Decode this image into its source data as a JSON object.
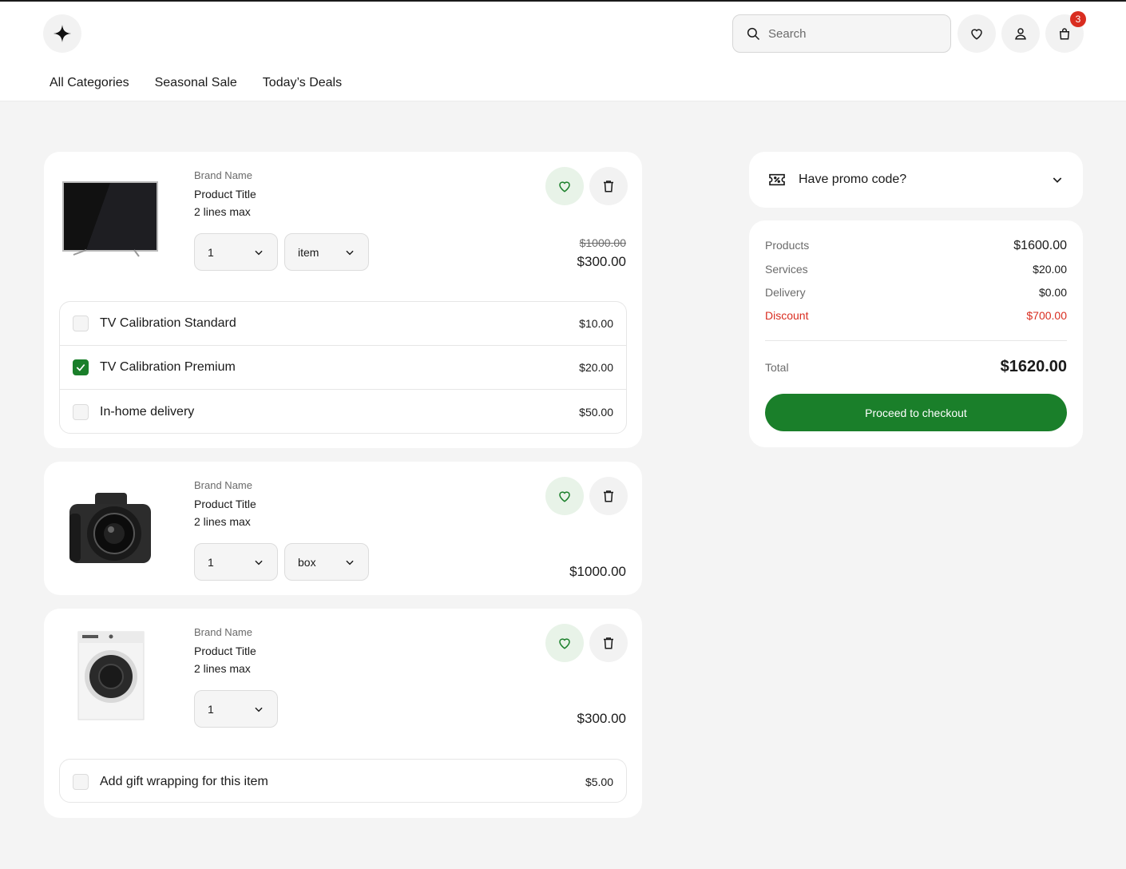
{
  "header": {
    "search_placeholder": "Search",
    "cart_count": "3",
    "nav": [
      "All Categories",
      "Seasonal Sale",
      "Today’s Deals"
    ]
  },
  "cart": {
    "items": [
      {
        "brand": "Brand Name",
        "title_line1": "Product Title",
        "title_line2": "2 lines max",
        "image": "tv",
        "quantity": "1",
        "unit": "item",
        "old_price": "$1000.00",
        "price": "$300.00",
        "options": [
          {
            "label": "TV Calibration Standard",
            "price": "$10.00",
            "checked": false
          },
          {
            "label": "TV Calibration Premium",
            "price": "$20.00",
            "checked": true
          },
          {
            "label": "In-home delivery",
            "price": "$50.00",
            "checked": false
          }
        ]
      },
      {
        "brand": "Brand Name",
        "title_line1": "Product Title",
        "title_line2": "2 lines max",
        "image": "camera",
        "quantity": "1",
        "unit": "box",
        "price": "$1000.00"
      },
      {
        "brand": "Brand Name",
        "title_line1": "Product Title",
        "title_line2": "2 lines max",
        "image": "washing-machine",
        "quantity": "1",
        "price": "$300.00",
        "options": [
          {
            "label": "Add gift wrapping for this item",
            "price": "$5.00",
            "checked": false
          }
        ]
      }
    ]
  },
  "promo": {
    "label": "Have promo code?"
  },
  "summary": {
    "products_label": "Products",
    "products_value": "$1600.00",
    "services_label": "Services",
    "services_value": "$20.00",
    "delivery_label": "Delivery",
    "delivery_value": "$0.00",
    "discount_label": "Discount",
    "discount_value": "$700.00",
    "total_label": "Total",
    "total_value": "$1620.00",
    "checkout_label": "Proceed to checkout"
  },
  "colors": {
    "accent": "#1a7f2a",
    "badge": "#d92d20",
    "discount": "#d92d20"
  },
  "icons": [
    "sparkle-logo-icon",
    "search-icon",
    "heart-icon",
    "user-icon",
    "bag-icon",
    "chevron-down-icon",
    "trash-icon",
    "ticket-percent-icon",
    "check-icon"
  ]
}
